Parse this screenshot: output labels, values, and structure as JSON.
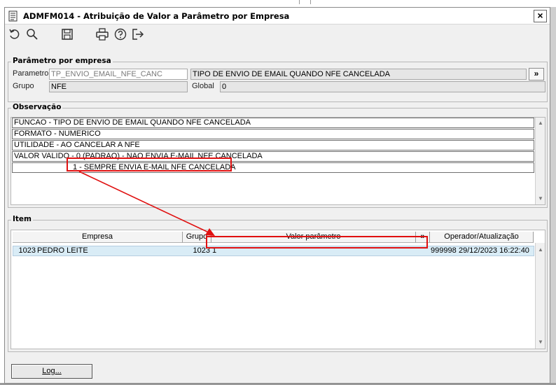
{
  "window": {
    "title": "ADMFM014 - Atribuição de Valor a Parâmetro por Empresa",
    "close_symbol": "×"
  },
  "toolbar": {
    "icons": [
      "undo-icon",
      "search-icon",
      "save-icon",
      "print-icon",
      "help-icon",
      "exit-icon"
    ]
  },
  "parametro_group": {
    "title": "Parâmetro por empresa",
    "parametro_label": "Parametro",
    "parametro_code": "TP_ENVIO_EMAIL_NFE_CANC",
    "parametro_desc": "TIPO DE ENVIO DE EMAIL QUANDO NFE CANCELADA",
    "lookup_button": "»",
    "grupo_label": "Grupo",
    "grupo_value": "NFE",
    "global_label": "Global",
    "global_value": "0"
  },
  "observacao_group": {
    "title": "Observação",
    "lines": [
      "FUNCAO - TIPO DE ENVIO DE EMAIL QUANDO NFE CANCELADA",
      "FORMATO - NUMERICO",
      "UTILIDADE - AO CANCELAR A NFE",
      "VALOR VALIDO - 0 (PADRAO) - NAO ENVIA E-MAIL NFE CANCELADA",
      "1 - SEMPRE ENVIA E-MAIL NFE CANCELADA"
    ]
  },
  "item_group": {
    "title": "Item",
    "columns": {
      "empresa": "Empresa",
      "grupo": "Grupo",
      "valor": "Valor parâmetro",
      "valor_lookup": "»",
      "operador": "Operador/Atualização"
    },
    "rows": [
      {
        "empresa_code": "1023",
        "empresa_name": "PEDRO LEITE",
        "grupo": "1023",
        "valor": "1",
        "operador": "999998",
        "atualizacao": "29/12/2023 16:22:40"
      }
    ]
  },
  "log_button": "Log...",
  "colors": {
    "highlight": "#e01010",
    "row_selected": "#d9ecf6",
    "window_bg": "#f0f0f0"
  }
}
